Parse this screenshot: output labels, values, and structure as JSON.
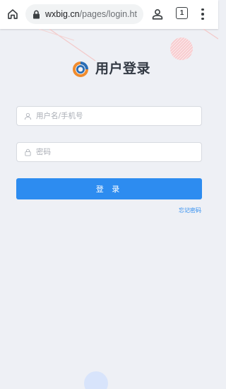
{
  "browser": {
    "url_domain": "wxbig.cn",
    "url_path": "/pages/login.ht",
    "tab_count": "1"
  },
  "login": {
    "title": "用户登录",
    "username_placeholder": "用户名/手机号",
    "password_placeholder": "密码",
    "submit_label": "登 录",
    "forgot_label": "忘记密码"
  },
  "colors": {
    "accent": "#2d8cf0",
    "background": "#eef0f5",
    "logo_orange": "#f08c2e",
    "logo_blue": "#2a6db5"
  }
}
